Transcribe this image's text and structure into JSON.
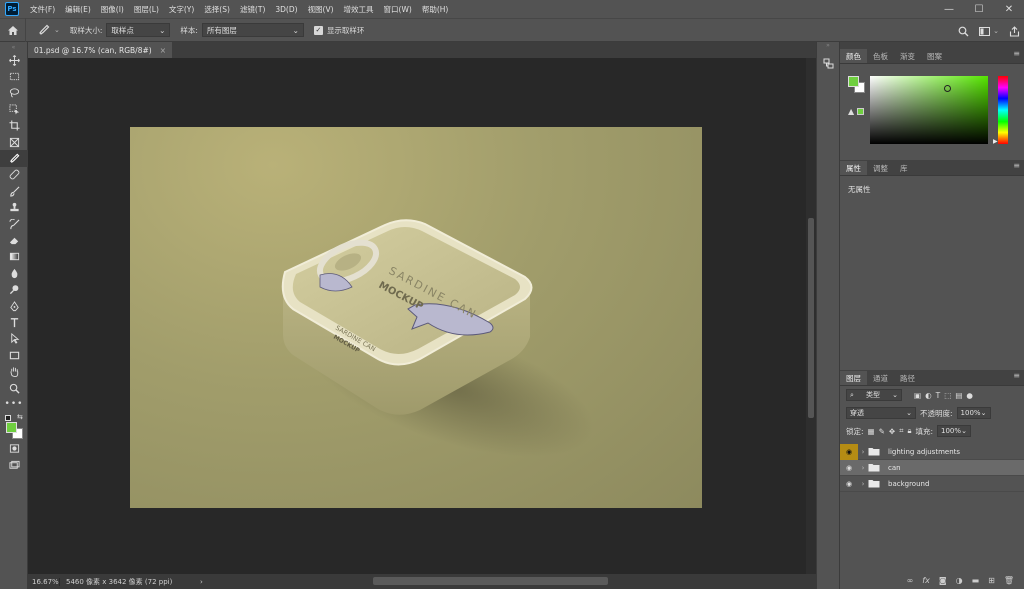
{
  "app": {
    "logo": "Ps"
  },
  "menu": [
    "文件(F)",
    "编辑(E)",
    "图像(I)",
    "图层(L)",
    "文字(Y)",
    "选择(S)",
    "滤镜(T)",
    "3D(D)",
    "视图(V)",
    "增效工具",
    "窗口(W)",
    "帮助(H)"
  ],
  "window_controls": {
    "minimize": "—",
    "maximize": "☐",
    "close": "✕"
  },
  "options_bar": {
    "sample_size_label": "取样大小:",
    "sample_size_value": "取样点",
    "sample_label": "样本:",
    "sample_value": "所有图层",
    "show_ring_label": "显示取样环",
    "show_ring_checked": true
  },
  "document": {
    "tab_title": "01.psd @ 16.7% (can, RGB/8#)",
    "tab_close": "×",
    "mockup_text": {
      "title_line1": "SARDINE CAN",
      "title_line2": "MOCKUP",
      "side_line1": "SARDINE CAN",
      "side_line2": "MOCKUP"
    }
  },
  "status": {
    "zoom": "16.67%",
    "info": "5460 像素 x 3642 像素 (72 ppi)",
    "arrow": "›"
  },
  "panels": {
    "color_tabs": [
      "颜色",
      "色板",
      "渐变",
      "图案"
    ],
    "properties_tabs": [
      "属性",
      "调整",
      "库"
    ],
    "properties_empty": "无属性",
    "layers_tabs": [
      "图层",
      "通道",
      "路径"
    ],
    "filter_kind": "类型",
    "blend_mode": "穿透",
    "opacity_label": "不透明度:",
    "opacity_value": "100%",
    "lock_label": "锁定:",
    "fill_label": "填充:",
    "fill_value": "100%",
    "layers": [
      {
        "name": "lighting adjustments",
        "selected": false,
        "eye_highlight": true
      },
      {
        "name": "can",
        "selected": true,
        "eye_highlight": false
      },
      {
        "name": "background",
        "selected": false,
        "eye_highlight": false
      }
    ],
    "footer_icons": [
      "link-icon",
      "fx-icon",
      "mask-icon",
      "adjustment-icon",
      "group-icon",
      "new-layer-icon",
      "trash-icon"
    ],
    "footer_fx": "fx"
  },
  "colors": {
    "foreground": "#6fcf3f",
    "background": "#ffffff",
    "canvas_bg": "#a19d6b",
    "highlight": "#b58c14"
  }
}
